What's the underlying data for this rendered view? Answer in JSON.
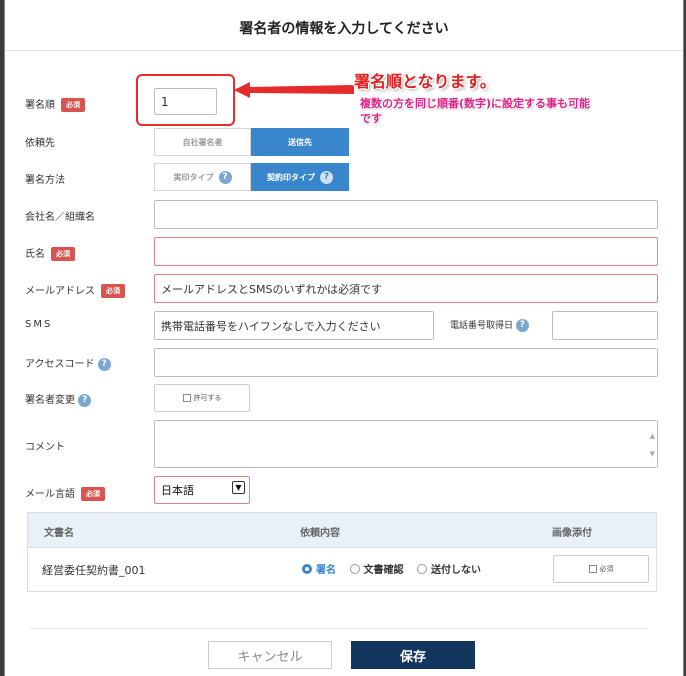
{
  "dialog": {
    "title": "署名者の情報を入力してください"
  },
  "annotation": {
    "main": "署名順となります。",
    "sub": "複数の方を同じ順番(数字)に設定する事も可能です",
    "color": "#e21f1f"
  },
  "required_label": "必須",
  "fields": {
    "order": {
      "label": "署名順",
      "value": "1"
    },
    "recipient": {
      "label": "依頼先",
      "options": [
        "自社署名者",
        "送信先"
      ],
      "selected": "送信先"
    },
    "method": {
      "label": "署名方法",
      "options": [
        "実印タイプ",
        "契約印タイプ"
      ],
      "selected": "契約印タイプ"
    },
    "company": {
      "label": "会社名／組織名",
      "value": ""
    },
    "name": {
      "label": "氏名",
      "value": ""
    },
    "email": {
      "label": "メールアドレス",
      "placeholder": "メールアドレスとSMSのいずれかは必須です"
    },
    "sms": {
      "label": "SMS",
      "placeholder": "携帯電話番号をハイフンなしで入力ください",
      "date_label": "電話番号取得日"
    },
    "access_code": {
      "label": "アクセスコード",
      "value": ""
    },
    "signer_change": {
      "label": "署名者変更",
      "checkbox_label": "許可する"
    },
    "comment": {
      "label": "コメント",
      "value": ""
    },
    "mail_language": {
      "label": "メール言語",
      "value": "日本語"
    }
  },
  "table": {
    "headers": [
      "文書名",
      "依頼内容",
      "画像添付"
    ],
    "rows": [
      {
        "document": "経営委任契約書_001",
        "options": [
          "署名",
          "文書確認",
          "送付しない"
        ],
        "selected": "署名",
        "attach_label": "必須"
      }
    ]
  },
  "footer": {
    "cancel": "キャンセル",
    "save": "保存"
  },
  "colors": {
    "accent": "#3a86cc",
    "required": "#d9534f",
    "save": "#13365e"
  }
}
